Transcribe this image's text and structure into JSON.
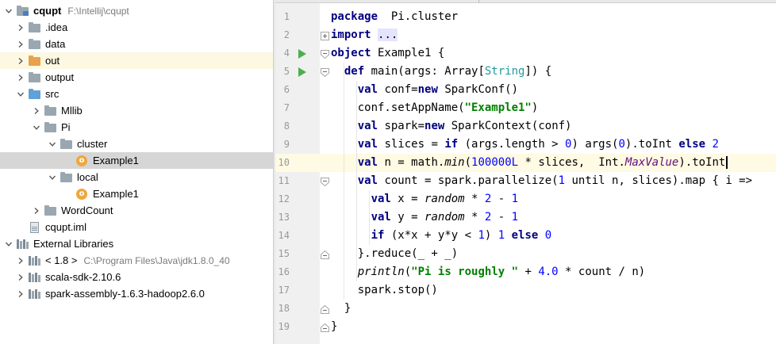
{
  "colors": {
    "selection": "#d6d6d6",
    "out_highlight": "#fdf8e2",
    "current_line": "#fffae3",
    "keyword": "#000080",
    "string": "#008000",
    "number": "#0000ff",
    "run_icon": "#4caf50"
  },
  "project_tree": {
    "items": [
      {
        "label": "cqupt",
        "path": "F:\\Intellij\\cqupt",
        "icon": "module-folder-icon",
        "arrow": "down",
        "depth": 0,
        "bold": true
      },
      {
        "label": ".idea",
        "icon": "folder-icon",
        "arrow": "right",
        "depth": 1
      },
      {
        "label": "data",
        "icon": "folder-icon",
        "arrow": "right",
        "depth": 1
      },
      {
        "label": "out",
        "icon": "excluded-folder-icon",
        "arrow": "right",
        "depth": 1,
        "highlight": true
      },
      {
        "label": "output",
        "icon": "folder-icon",
        "arrow": "right",
        "depth": 1
      },
      {
        "label": "src",
        "icon": "source-folder-icon",
        "arrow": "down",
        "depth": 1
      },
      {
        "label": "Mllib",
        "icon": "package-icon",
        "arrow": "right",
        "depth": 2
      },
      {
        "label": "Pi",
        "icon": "package-icon",
        "arrow": "down",
        "depth": 2
      },
      {
        "label": "cluster",
        "icon": "package-icon",
        "arrow": "down",
        "depth": 3
      },
      {
        "label": "Example1",
        "icon": "scala-object-icon",
        "arrow": "none",
        "depth": 4,
        "selected": true
      },
      {
        "label": "local",
        "icon": "package-icon",
        "arrow": "down",
        "depth": 3
      },
      {
        "label": "Example1",
        "icon": "scala-object-icon",
        "arrow": "none",
        "depth": 4
      },
      {
        "label": "WordCount",
        "icon": "package-icon",
        "arrow": "right",
        "depth": 2
      },
      {
        "label": "cqupt.iml",
        "icon": "iml-file-icon",
        "arrow": "none",
        "depth": 1
      },
      {
        "label": "External Libraries",
        "icon": "library-icon",
        "arrow": "down",
        "depth": 0
      },
      {
        "label": "< 1.8 >",
        "path": "C:\\Program Files\\Java\\jdk1.8.0_40",
        "icon": "jdk-icon",
        "arrow": "right",
        "depth": 1
      },
      {
        "label": "scala-sdk-2.10.6",
        "icon": "library-icon",
        "arrow": "right",
        "depth": 1
      },
      {
        "label": "spark-assembly-1.6.3-hadoop2.6.0",
        "icon": "library-icon",
        "arrow": "right",
        "depth": 1
      }
    ]
  },
  "editor": {
    "current_line": 10,
    "run_lines": [
      4,
      5
    ],
    "lines": [
      {
        "n": "1",
        "tokens": [
          [
            "kw",
            "package"
          ],
          [
            "",
            "  Pi.cluster"
          ]
        ]
      },
      {
        "n": "2",
        "tokens": [
          [
            "kw",
            "import"
          ],
          [
            "",
            " "
          ],
          [
            "fold",
            "..."
          ]
        ],
        "fold": "plus"
      },
      {
        "n": "4",
        "tokens": [
          [
            "kw",
            "object"
          ],
          [
            "",
            " Example1 {"
          ]
        ],
        "fold": "open"
      },
      {
        "n": "5",
        "tokens": [
          [
            "",
            "  "
          ],
          [
            "kw",
            "def"
          ],
          [
            "",
            " main(args: Array["
          ],
          [
            "typ",
            "String"
          ],
          [
            "",
            "]) {"
          ]
        ],
        "fold": "open"
      },
      {
        "n": "6",
        "tokens": [
          [
            "",
            "    "
          ],
          [
            "kw",
            "val"
          ],
          [
            "",
            " conf="
          ],
          [
            "kw",
            "new"
          ],
          [
            "",
            " SparkConf()"
          ]
        ]
      },
      {
        "n": "7",
        "tokens": [
          [
            "",
            "    conf.setAppName("
          ],
          [
            "str",
            "\"Example1\""
          ],
          [
            "",
            ")"
          ]
        ]
      },
      {
        "n": "8",
        "tokens": [
          [
            "",
            "    "
          ],
          [
            "kw",
            "val"
          ],
          [
            "",
            " spark="
          ],
          [
            "kw",
            "new"
          ],
          [
            "",
            " SparkContext(conf)"
          ]
        ]
      },
      {
        "n": "9",
        "tokens": [
          [
            "",
            "    "
          ],
          [
            "kw",
            "val"
          ],
          [
            "",
            " slices = "
          ],
          [
            "kw",
            "if"
          ],
          [
            "",
            " (args.length > "
          ],
          [
            "num",
            "0"
          ],
          [
            "",
            ") args("
          ],
          [
            "num",
            "0"
          ],
          [
            "",
            ").toInt "
          ],
          [
            "kw",
            "else"
          ],
          [
            "",
            " "
          ],
          [
            "num",
            "2"
          ]
        ]
      },
      {
        "n": "10",
        "tokens": [
          [
            "",
            "    "
          ],
          [
            "kw",
            "val"
          ],
          [
            "",
            " n = math."
          ],
          [
            "it",
            "min"
          ],
          [
            "",
            "("
          ],
          [
            "num",
            "100000L"
          ],
          [
            "",
            " * slices,  Int."
          ],
          [
            "cst",
            "MaxValue"
          ],
          [
            "",
            ").toInt"
          ]
        ],
        "caret": true
      },
      {
        "n": "11",
        "tokens": [
          [
            "",
            "    "
          ],
          [
            "kw",
            "val"
          ],
          [
            "",
            " count = spark.parallelize("
          ],
          [
            "num",
            "1"
          ],
          [
            "",
            " until n, slices).map { i =>"
          ]
        ],
        "fold": "open"
      },
      {
        "n": "12",
        "tokens": [
          [
            "",
            "      "
          ],
          [
            "kw",
            "val"
          ],
          [
            "",
            " x = "
          ],
          [
            "it",
            "random"
          ],
          [
            "",
            " * "
          ],
          [
            "num",
            "2"
          ],
          [
            "",
            " - "
          ],
          [
            "num",
            "1"
          ]
        ]
      },
      {
        "n": "13",
        "tokens": [
          [
            "",
            "      "
          ],
          [
            "kw",
            "val"
          ],
          [
            "",
            " y = "
          ],
          [
            "it",
            "random"
          ],
          [
            "",
            " * "
          ],
          [
            "num",
            "2"
          ],
          [
            "",
            " - "
          ],
          [
            "num",
            "1"
          ]
        ]
      },
      {
        "n": "14",
        "tokens": [
          [
            "",
            "      "
          ],
          [
            "kw",
            "if"
          ],
          [
            "",
            " (x*x + y*y < "
          ],
          [
            "num",
            "1"
          ],
          [
            "",
            ") "
          ],
          [
            "num",
            "1"
          ],
          [
            "",
            " "
          ],
          [
            "kw",
            "else"
          ],
          [
            "",
            " "
          ],
          [
            "num",
            "0"
          ]
        ]
      },
      {
        "n": "15",
        "tokens": [
          [
            "",
            "    }.reduce(_ + _)"
          ]
        ],
        "fold": "close"
      },
      {
        "n": "16",
        "tokens": [
          [
            "",
            "    "
          ],
          [
            "it",
            "println"
          ],
          [
            "",
            "("
          ],
          [
            "str",
            "\"Pi is roughly \""
          ],
          [
            "",
            " + "
          ],
          [
            "num",
            "4.0"
          ],
          [
            "",
            " * count / n)"
          ]
        ]
      },
      {
        "n": "17",
        "tokens": [
          [
            "",
            "    spark.stop()"
          ]
        ]
      },
      {
        "n": "18",
        "tokens": [
          [
            "",
            "  }"
          ]
        ],
        "fold": "close"
      },
      {
        "n": "19",
        "tokens": [
          [
            "",
            "}"
          ]
        ],
        "fold": "close"
      }
    ]
  }
}
